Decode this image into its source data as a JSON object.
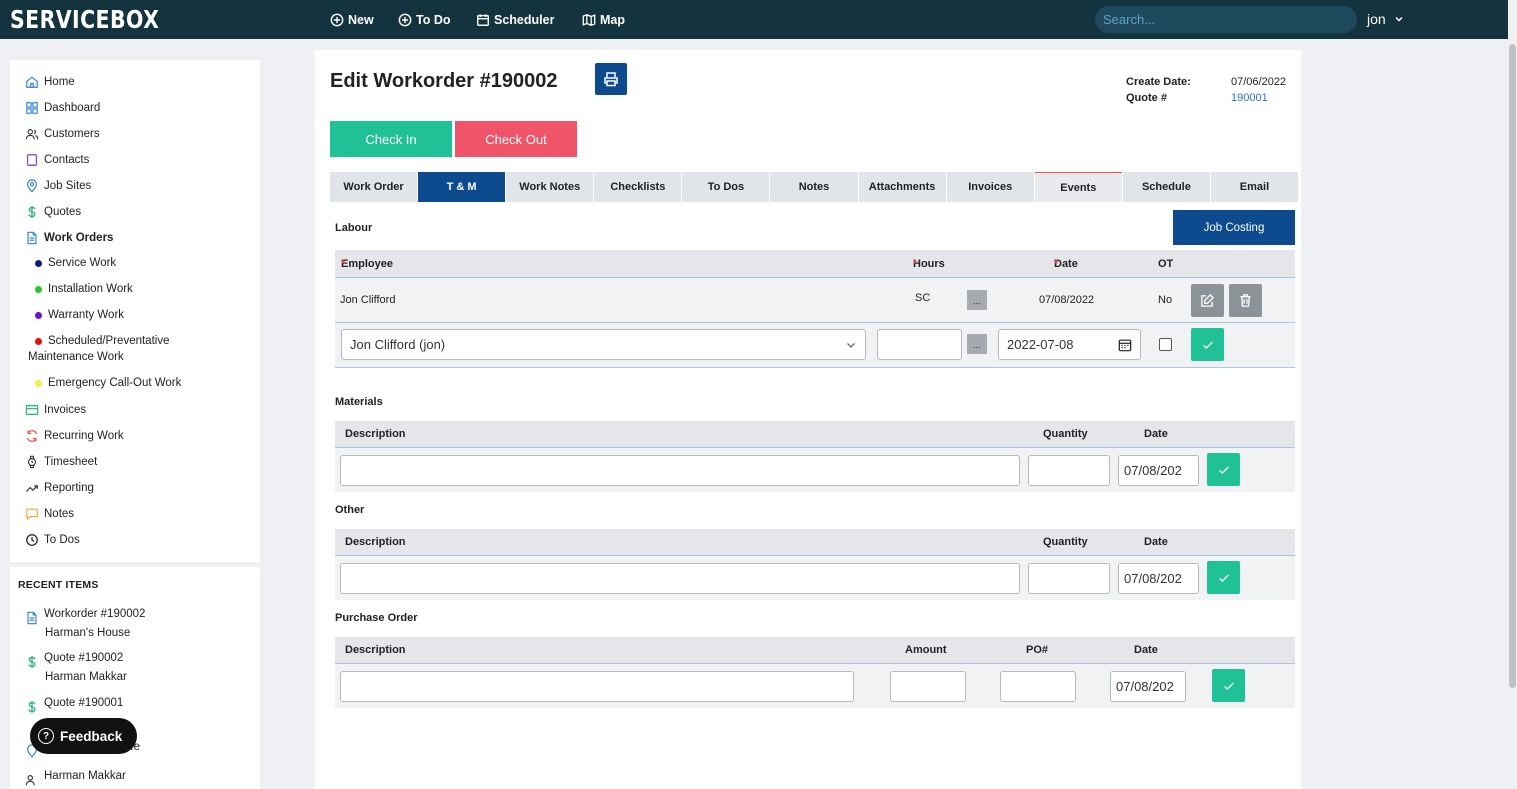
{
  "app": {
    "logo": "SERVICEBOX"
  },
  "topnav": [
    {
      "label": "New",
      "icon": "plus-circle-icon"
    },
    {
      "label": "To Do",
      "icon": "plus-circle-icon"
    },
    {
      "label": "Scheduler",
      "icon": "calendar-icon"
    },
    {
      "label": "Map",
      "icon": "map-icon"
    }
  ],
  "search": {
    "placeholder": "Search..."
  },
  "user": {
    "name": "jon"
  },
  "sidebar": {
    "items": [
      {
        "label": "Home",
        "icon": "home-icon"
      },
      {
        "label": "Dashboard",
        "icon": "dashboard-icon"
      },
      {
        "label": "Customers",
        "icon": "users-icon"
      },
      {
        "label": "Contacts",
        "icon": "contact-book-icon"
      },
      {
        "label": "Job Sites",
        "icon": "location-pin-icon"
      },
      {
        "label": "Quotes",
        "icon": "dollar-icon"
      },
      {
        "label": "Work Orders",
        "icon": "document-icon"
      },
      {
        "label": "Invoices",
        "icon": "credit-card-icon"
      },
      {
        "label": "Recurring Work",
        "icon": "refresh-icon"
      },
      {
        "label": "Timesheet",
        "icon": "watch-icon"
      },
      {
        "label": "Reporting",
        "icon": "trending-up-icon"
      },
      {
        "label": "Notes",
        "icon": "chat-bubble-icon"
      },
      {
        "label": "To Dos",
        "icon": "clock-icon"
      }
    ],
    "work_order_types": [
      {
        "label": "Service Work",
        "color": "#0b1a7a"
      },
      {
        "label": "Installation Work",
        "color": "#2bc52b"
      },
      {
        "label": "Warranty Work",
        "color": "#6a14c4"
      },
      {
        "label": "Scheduled/Preventative",
        "label2": "Maintenance Work",
        "color": "#e31010"
      },
      {
        "label": "Emergency Call-Out Work",
        "color": "#f5f044"
      }
    ]
  },
  "recent": {
    "title": "RECENT ITEMS",
    "items": [
      {
        "label": "Workorder #190002",
        "sub": "Harman's House",
        "icon": "document-icon"
      },
      {
        "label": "Quote #190002",
        "sub": "Harman Makkar",
        "icon": "dollar-icon"
      },
      {
        "label": "Quote #190001",
        "sub": "",
        "icon": "dollar-icon"
      },
      {
        "label": "...e",
        "sub": "",
        "icon": "location-pin-icon"
      },
      {
        "label": "Harman Makkar",
        "sub": "",
        "icon": "users-icon"
      }
    ]
  },
  "feedback": {
    "label": "Feedback"
  },
  "page": {
    "title": "Edit Workorder #190002",
    "create_date_label": "Create Date:",
    "create_date": "07/06/2022",
    "quote_label": "Quote #",
    "quote_value": "190001",
    "check_in": "Check In",
    "check_out": "Check Out"
  },
  "tabs": [
    "Work Order",
    "T & M",
    "Work Notes",
    "Checklists",
    "To Dos",
    "Notes",
    "Attachments",
    "Invoices",
    "Events",
    "Schedule",
    "Email"
  ],
  "active_tab": "T & M",
  "labour": {
    "title": "Labour",
    "job_costing": "Job Costing",
    "headers": {
      "employee": "Employee",
      "hours": "Hours",
      "date": "Date",
      "ot": "OT",
      "req": "*"
    },
    "row": {
      "employee": "Jon Clifford",
      "hours": "SC",
      "date": "07/08/2022",
      "ot": "No"
    },
    "form": {
      "employee": "Jon Clifford (jon)",
      "date": "2022-07-08",
      "dots": "..."
    }
  },
  "materials": {
    "title": "Materials",
    "headers": {
      "description": "Description",
      "quantity": "Quantity",
      "date": "Date"
    },
    "date": "07/08/202"
  },
  "other": {
    "title": "Other",
    "headers": {
      "description": "Description",
      "quantity": "Quantity",
      "date": "Date"
    },
    "date": "07/08/202"
  },
  "purchase_order": {
    "title": "Purchase Order",
    "headers": {
      "description": "Description",
      "amount": "Amount",
      "po": "PO#",
      "date": "Date"
    },
    "date": "07/08/202"
  }
}
